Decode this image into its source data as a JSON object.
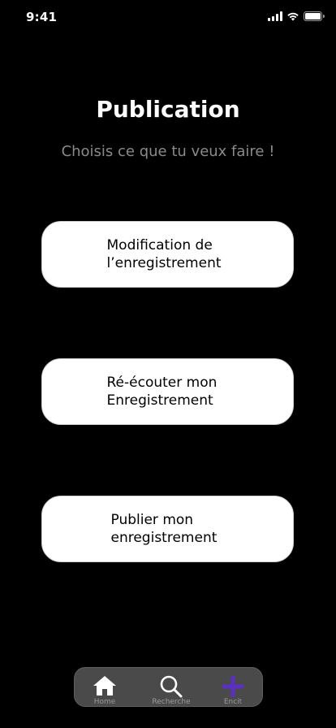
{
  "status_bar": {
    "time": "9:41"
  },
  "header": {
    "title": "Publication",
    "subtitle": "Choisis ce que tu veux faire !"
  },
  "actions": [
    {
      "label": "Modification de\nl’enregistrement"
    },
    {
      "label": "Ré-écouter mon\nEnregistrement"
    },
    {
      "label": "Publier mon\nenregistrement"
    }
  ],
  "tab_bar": {
    "items": [
      {
        "label": "Home",
        "icon": "home-icon"
      },
      {
        "label": "Recherche",
        "icon": "search-icon"
      },
      {
        "label": "Encit",
        "icon": "plus-icon"
      }
    ]
  },
  "colors": {
    "background": "#000000",
    "accent": "#5a2fc2",
    "subtitle": "#8a8a8a",
    "card": "#ffffff",
    "tab_bar": "#4a4a4a"
  }
}
